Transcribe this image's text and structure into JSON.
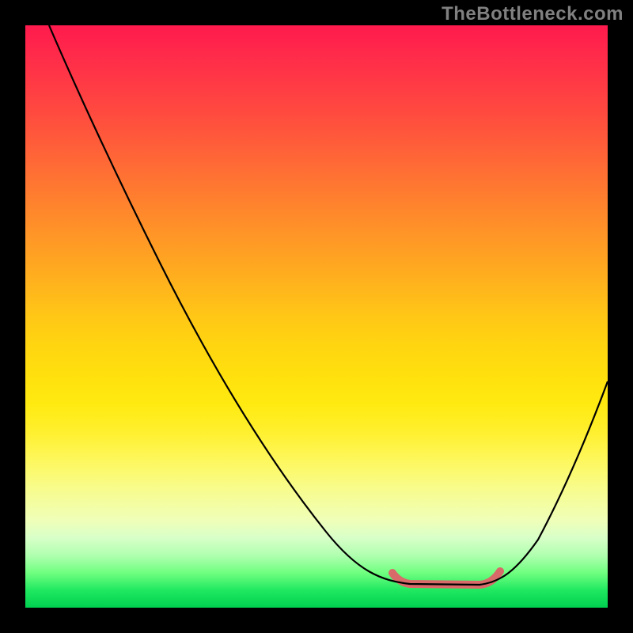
{
  "watermark": "TheBottleneck.com",
  "chart_data": {
    "type": "line",
    "title": "",
    "xlabel": "",
    "ylabel": "",
    "x_range": [
      0,
      1
    ],
    "y_range": [
      0,
      1
    ],
    "description": "Bottleneck curve over a vertical red-to-green gradient. Lower y = better (green). Curve falls steeply from top-left, flattens near y≈0.04 between x≈0.63 and x≈0.80 (highlighted in salmon), then rises toward the right edge.",
    "series": [
      {
        "name": "bottleneck-curve",
        "x": [
          0.04,
          0.1,
          0.18,
          0.26,
          0.34,
          0.42,
          0.5,
          0.58,
          0.63,
          0.66,
          0.72,
          0.78,
          0.8,
          0.84,
          0.9,
          0.96,
          1.0
        ],
        "y": [
          1.0,
          0.9,
          0.76,
          0.62,
          0.48,
          0.34,
          0.22,
          0.12,
          0.07,
          0.04,
          0.04,
          0.04,
          0.05,
          0.1,
          0.22,
          0.34,
          0.4
        ]
      }
    ],
    "highlight_range_x": [
      0.63,
      0.8
    ],
    "gradient_stops": [
      {
        "pos": 0.0,
        "color": "#ff1a4d"
      },
      {
        "pos": 0.25,
        "color": "#ff6e34"
      },
      {
        "pos": 0.5,
        "color": "#ffc716"
      },
      {
        "pos": 0.75,
        "color": "#fdf860"
      },
      {
        "pos": 0.9,
        "color": "#b0ffb0"
      },
      {
        "pos": 1.0,
        "color": "#00d050"
      }
    ]
  }
}
